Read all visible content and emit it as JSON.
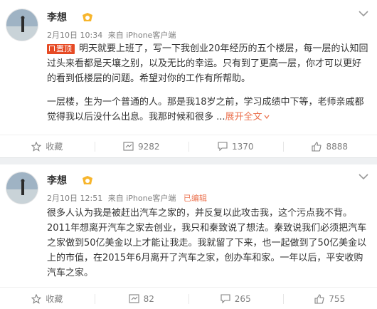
{
  "posts": [
    {
      "author": "李想",
      "time": "2月10日 10:34",
      "source": "来自 iPhone客户端",
      "pin_label": "置顶",
      "text1": "明天就要上班了，写一下我创业20年经历的五个楼层，每一层的认知回过头来看都是天壤之别，以及无比的幸运。只有到了更高一层，你才可以更好的看到低楼层的问题。希望对你的工作有所帮助。",
      "text2": "一层楼，生为一个普通的人。那是我18岁之前，学习成绩中下等，老师亲戚都觉得我以后没什么出息。我那时候和很多 ...",
      "expand_label": "展开全文",
      "actions": {
        "save": "收藏",
        "repost": "9282",
        "comment": "1370",
        "like": "8888"
      }
    },
    {
      "author": "李想",
      "time": "2月10日 12:51",
      "source": "来自 iPhone客户端",
      "edited": "已编辑",
      "text1": "很多人认为我是被赶出汽车之家的，并反复以此攻击我，这个污点我不背。2011年想离开汽车之家去创业，我只和秦致说了想法。秦致说我们必须把汽车之家做到50亿美金以上才能让我走。我就留了下来，也一起做到了50亿美金以上的市值，在2015年6月离开了汽车之家，创办车和家。一年以后，平安收购汽车之家。",
      "actions": {
        "save": "收藏",
        "repost": "82",
        "comment": "265",
        "like": "755"
      }
    }
  ],
  "colors": {
    "accent": "#eb7350",
    "pin": "#e64a24",
    "vip": "#f7b52c"
  }
}
